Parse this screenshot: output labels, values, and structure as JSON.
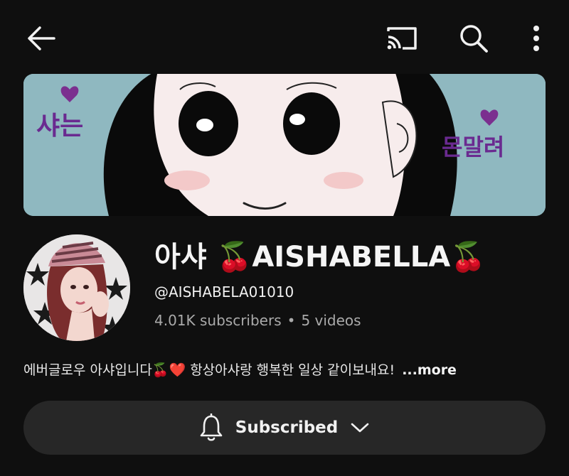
{
  "topbar": {
    "back_icon": "arrow-left-icon",
    "cast_icon": "cast-icon",
    "search_icon": "search-icon",
    "more_icon": "more-vert-icon"
  },
  "banner": {
    "left_text": "샤는",
    "right_text": "몬말려",
    "bg_color": "#8fb8c0"
  },
  "channel": {
    "name": "아샤 🍒AISHABELLA🍒",
    "handle": "@AISHABELA01010",
    "subscribers": "4.01K subscribers",
    "separator": "•",
    "videos": "5 videos",
    "description": "에버글로우 아샤입니다🍒❤️ 항상아샤랑 행복한 일상 같이보내요!",
    "more_label": "...more"
  },
  "subscribe_button": {
    "label": "Subscribed",
    "bell_icon": "bell-icon",
    "chevron_icon": "chevron-down-icon"
  }
}
